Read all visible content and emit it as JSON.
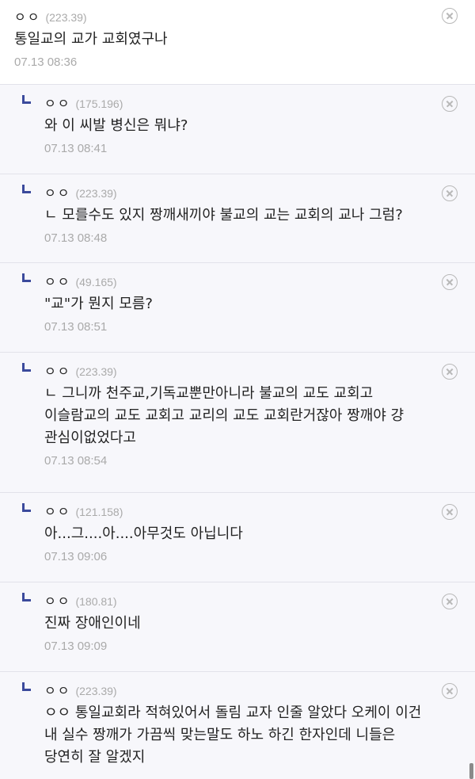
{
  "comments": [
    {
      "nick": "ㅇㅇ",
      "ip": "(223.39)",
      "text": "통일교의 교가 교회였구나",
      "date": "07.13 08:36"
    },
    {
      "nick": "ㅇㅇ",
      "ip": "(175.196)",
      "text": "와 이 씨발 병신은 뭐냐?",
      "date": "07.13 08:41"
    },
    {
      "nick": "ㅇㅇ",
      "ip": "(223.39)",
      "text": "ㄴ 모를수도 있지 짱깨새끼야 불교의 교는 교회의 교나 그럼?",
      "date": "07.13 08:48"
    },
    {
      "nick": "ㅇㅇ",
      "ip": "(49.165)",
      "text": "\"교\"가 뭔지 모름?",
      "date": "07.13 08:51"
    },
    {
      "nick": "ㅇㅇ",
      "ip": "(223.39)",
      "text": "ㄴ 그니까 천주교,기독교뿐만아니라 불교의 교도 교회고 이슬람교의 교도 교회고 교리의 교도 교회란거잖아 짱깨야 걍 관심이없었다고",
      "date": "07.13 08:54"
    },
    {
      "nick": "ㅇㅇ",
      "ip": "(121.158)",
      "text": "아...그....아....아무것도 아닙니다",
      "date": "07.13 09:06"
    },
    {
      "nick": "ㅇㅇ",
      "ip": "(180.81)",
      "text": "진짜 장애인이네",
      "date": "07.13 09:09"
    },
    {
      "nick": "ㅇㅇ",
      "ip": "(223.39)",
      "text": "ㅇㅇ 통일교회라 적혀있어서 돌림 교자 인줄 알았다 오케이 이건 내 실수 짱깨가 가끔씩 맞는말도 하노 하긴 한자인데 니들은 당연히 잘 알겠지",
      "date": ""
    }
  ]
}
